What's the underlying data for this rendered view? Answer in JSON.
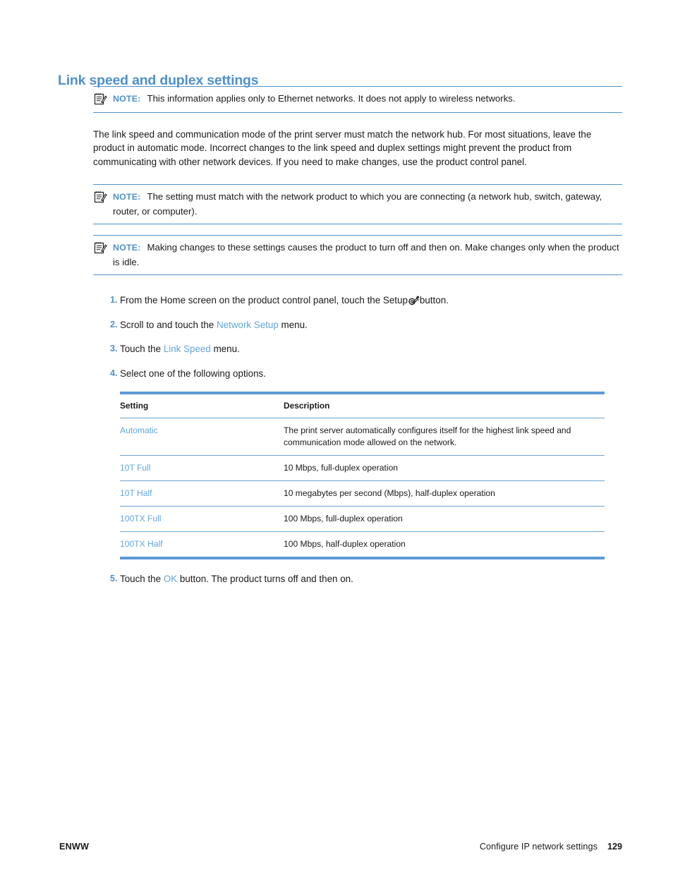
{
  "document": {
    "heading": "Link speed and duplex settings"
  },
  "notes": [
    {
      "icon": "note-icon",
      "label": "NOTE:",
      "text": "This information applies only to Ethernet networks. It does not apply to wireless networks."
    },
    {
      "icon": "note-icon",
      "label": "NOTE:",
      "text": "The setting must match with the network product to which you are connecting (a network hub, switch, gateway, router, or computer)."
    },
    {
      "icon": "note-icon",
      "label": "NOTE:",
      "text": "Making changes to these settings causes the product to turn off and then on. Make changes only when the product is idle."
    }
  ],
  "paragraph": "The link speed and communication mode of the print server must match the network hub. For most situations, leave the product in automatic mode. Incorrect changes to the link speed and duplex settings might prevent the product from communicating with other network devices. If you need to make changes, use the product control panel.",
  "steps": [
    {
      "number": "1.",
      "text_before": "From the Home screen on the product control panel, touch the Setup",
      "icon": "setup-gear-wrench-icon",
      "text_after": "button."
    },
    {
      "number": "2.",
      "text_before": "Scroll to and touch the",
      "ui_term": "Network Setup",
      "text_after": "menu."
    },
    {
      "number": "3.",
      "text_before": "Touch the",
      "ui_term": "Link Speed",
      "text_after": "menu."
    },
    {
      "number": "4.",
      "text_before": "Select one of the following options.",
      "ui_term": "",
      "text_after": ""
    },
    {
      "number": "5.",
      "text_before": "Touch the",
      "ui_term": "OK",
      "text_after": "button. The product turns off and then on."
    }
  ],
  "table": {
    "headers": [
      "Setting",
      "Description"
    ],
    "rows": [
      {
        "setting": "Automatic",
        "description": "The print server automatically configures itself for the highest link speed and communication mode allowed on the network."
      },
      {
        "setting": "10T Full",
        "description": "10 Mbps, full-duplex operation"
      },
      {
        "setting": "10T Half",
        "description": "10 megabytes per second (Mbps), half-duplex operation"
      },
      {
        "setting": "100TX Full",
        "description": "100 Mbps, full-duplex operation"
      },
      {
        "setting": "100TX Half",
        "description": "100 Mbps, half-duplex operation"
      }
    ]
  },
  "footer": {
    "left": "ENWW",
    "right": "Configure IP network settings",
    "page_number": "129"
  },
  "colors": {
    "accent_blue": "#4f91c9",
    "link_blue": "#62a7d8",
    "rule_blue": "#5b9bd5",
    "text": "#1a1a1a"
  }
}
